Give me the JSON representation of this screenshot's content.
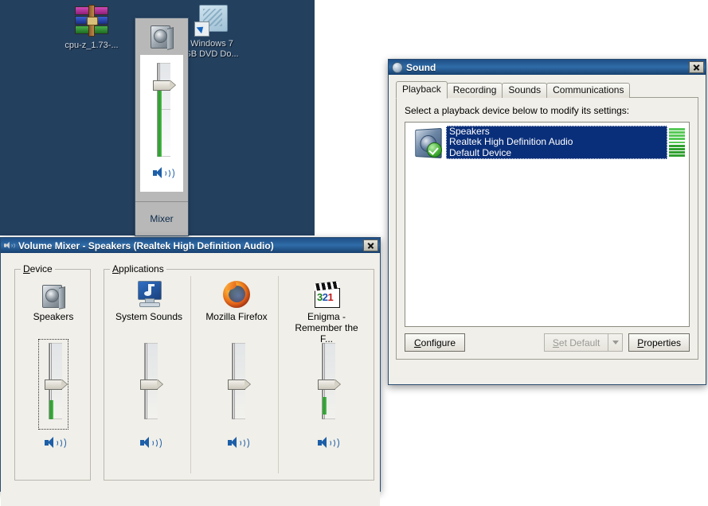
{
  "desktop": {
    "background_color": "#24405f",
    "icons": [
      {
        "name": "cpu-z-archive",
        "label": "cpu-z_1.73-...",
        "icon": "winrar-archive-icon"
      },
      {
        "name": "windows7-usb-dvd",
        "label": "Windows 7\nSB DVD Do...",
        "label_line1": "Windows 7",
        "label_line2": "SB DVD Do...",
        "icon": "folder-shortcut-icon"
      }
    ]
  },
  "volume_flyout": {
    "device_icon": "speaker-icon",
    "slider": {
      "value": 85,
      "orientation": "vertical"
    },
    "mute_icon": "speaker-volume-icon",
    "mixer_link": "Mixer"
  },
  "sound_dialog": {
    "title": "Sound",
    "title_icon": "sound-icon",
    "close_label": "✕",
    "tabs": [
      {
        "label": "Playback",
        "active": true
      },
      {
        "label": "Recording",
        "active": false
      },
      {
        "label": "Sounds",
        "active": false
      },
      {
        "label": "Communications",
        "active": false
      }
    ],
    "hint": "Select a playback device below to modify its settings:",
    "devices": [
      {
        "name": "Speakers",
        "driver": "Realtek High Definition Audio",
        "status": "Default Device",
        "selected": true,
        "default_check": true,
        "meter_segments": 9,
        "meter_level": 9
      }
    ],
    "buttons": {
      "configure": "Configure",
      "configure_accel": "C",
      "set_default": "Set Default",
      "set_default_accel": "S",
      "set_default_enabled": false,
      "properties": "Properties",
      "properties_accel": "P"
    }
  },
  "volume_mixer": {
    "title": "Volume Mixer - Speakers (Realtek High Definition Audio)",
    "title_icon": "volume-mixer-icon",
    "close_label": "✕",
    "groups": {
      "device": {
        "caption": "Device",
        "caption_accel": "D"
      },
      "applications": {
        "caption": "Applications",
        "caption_accel": "A"
      }
    },
    "device_channel": {
      "name": "Speakers",
      "icon": "speaker-icon",
      "slider": {
        "value": 45
      },
      "level": 18,
      "focused": true,
      "mute_icon": "speaker-volume-icon"
    },
    "app_channels": [
      {
        "name": "System Sounds",
        "icon": "system-sounds-icon",
        "slider": {
          "value": 45
        },
        "level": 0,
        "mute_icon": "speaker-volume-icon"
      },
      {
        "name": "Mozilla Firefox",
        "icon": "firefox-icon",
        "slider": {
          "value": 45
        },
        "level": 0,
        "mute_icon": "speaker-volume-icon"
      },
      {
        "name": "Enigma - Remember the F...",
        "name_line1": "Enigma -",
        "name_line2": "Remember the F...",
        "icon": "media-player-classic-icon",
        "slider": {
          "value": 45
        },
        "level": 22,
        "mute_icon": "speaker-volume-icon"
      }
    ]
  }
}
